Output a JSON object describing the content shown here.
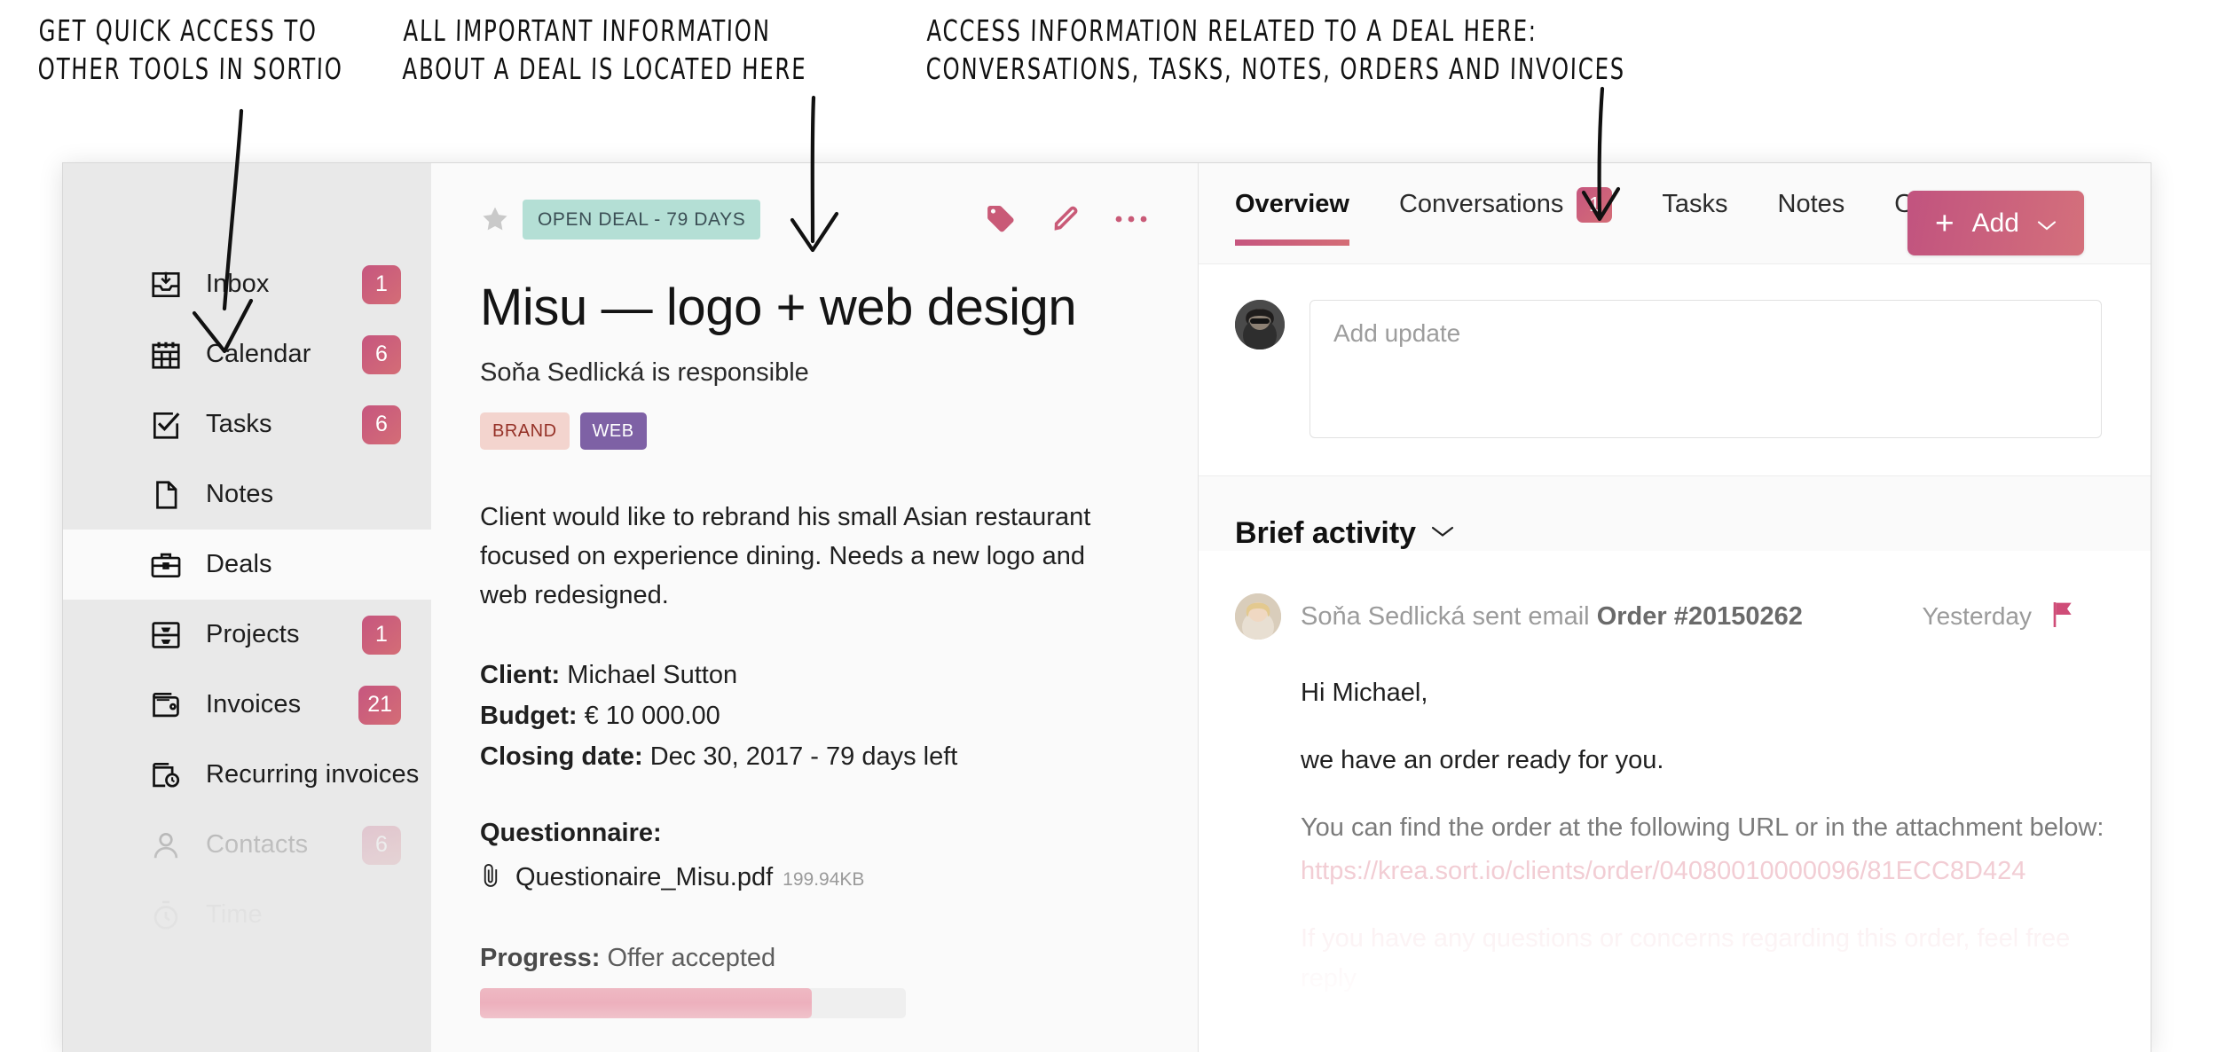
{
  "annotations": [
    {
      "id": "anno-sidebar",
      "text": "Get quick access to\nother tools in Sortio"
    },
    {
      "id": "anno-deal",
      "text": "All important information\nabout a deal is located here"
    },
    {
      "id": "anno-tabs",
      "text": "Access information related to a deal here:\nconversations, tasks, notes, orders and invoices"
    }
  ],
  "sidebar": {
    "items": [
      {
        "label": "Inbox",
        "badge": "1",
        "icon": "inbox-icon",
        "state": "normal"
      },
      {
        "label": "Calendar",
        "badge": "6",
        "icon": "calendar-icon",
        "state": "normal"
      },
      {
        "label": "Tasks",
        "badge": "6",
        "icon": "tasks-icon",
        "state": "normal"
      },
      {
        "label": "Notes",
        "badge": "",
        "icon": "notes-icon",
        "state": "normal"
      },
      {
        "label": "Deals",
        "badge": "",
        "icon": "deals-icon",
        "state": "active"
      },
      {
        "label": "Projects",
        "badge": "1",
        "icon": "projects-icon",
        "state": "normal"
      },
      {
        "label": "Invoices",
        "badge": "21",
        "icon": "invoices-icon",
        "state": "normal"
      },
      {
        "label": "Recurring invoices",
        "badge": "",
        "icon": "recurring-invoices-icon",
        "state": "normal"
      },
      {
        "label": "Contacts",
        "badge": "6",
        "icon": "contacts-icon",
        "state": "dim"
      },
      {
        "label": "Time",
        "badge": "",
        "icon": "time-icon",
        "state": "dim2"
      }
    ]
  },
  "deal": {
    "status_badge": "OPEN DEAL - 79 DAYS",
    "title": "Misu — logo + web design",
    "responsible": "Soňa Sedlická is responsible",
    "tags": [
      {
        "label": "BRAND",
        "color": "#f3d4ce",
        "text_color": "#953127"
      },
      {
        "label": "WEB",
        "color": "#7e61a5",
        "text_color": "#ffffff"
      }
    ],
    "description": "Client would like to rebrand his small Asian restaurant focused on experience dining. Needs a new logo and web redesigned.",
    "fields": [
      {
        "label": "Client:",
        "value": "Michael Sutton"
      },
      {
        "label": "Budget:",
        "value": "€ 10 000.00"
      },
      {
        "label": "Closing date:",
        "value": "Dec 30, 2017 - 79 days left"
      }
    ],
    "questionnaire_label": "Questionnaire:",
    "attachment": {
      "name": "Questionaire_Misu.pdf",
      "size": "199.94KB"
    },
    "progress": {
      "label": "Progress:",
      "value": "Offer accepted",
      "percent": 78
    }
  },
  "tabs": [
    {
      "label": "Overview",
      "badge": "",
      "active": true
    },
    {
      "label": "Conversations",
      "badge": "1",
      "active": false
    },
    {
      "label": "Tasks",
      "badge": "",
      "active": false
    },
    {
      "label": "Notes",
      "badge": "",
      "active": false
    },
    {
      "label": "Orders",
      "badge": "",
      "active": false
    }
  ],
  "add_button": {
    "label": "Add",
    "plus": "+"
  },
  "update": {
    "placeholder": "Add update"
  },
  "brief": {
    "title": "Brief activity"
  },
  "activity": {
    "author": "Soňa Sedlická sent email ",
    "subject": "Order #20150262",
    "time": "Yesterday",
    "lines": [
      {
        "text": "Hi Michael,",
        "style": "normal"
      },
      {
        "text": "we have an order ready for you.",
        "style": "normal"
      },
      {
        "text": "You can find the order at the following URL or in the attachment below:",
        "style": "muted"
      },
      {
        "text": "https://krea.sort.io/clients/order/04080010000096/81ECC8D424",
        "style": "link"
      },
      {
        "text": "If you have any questions or concerns regarding this order, feel free reply",
        "style": "ghost"
      }
    ]
  },
  "colors": {
    "accent_pink": "#c6567f",
    "accent_pink2": "#d46d76",
    "status_teal": "#b4dfd5",
    "sidebar_bg": "#e9e9e9"
  }
}
